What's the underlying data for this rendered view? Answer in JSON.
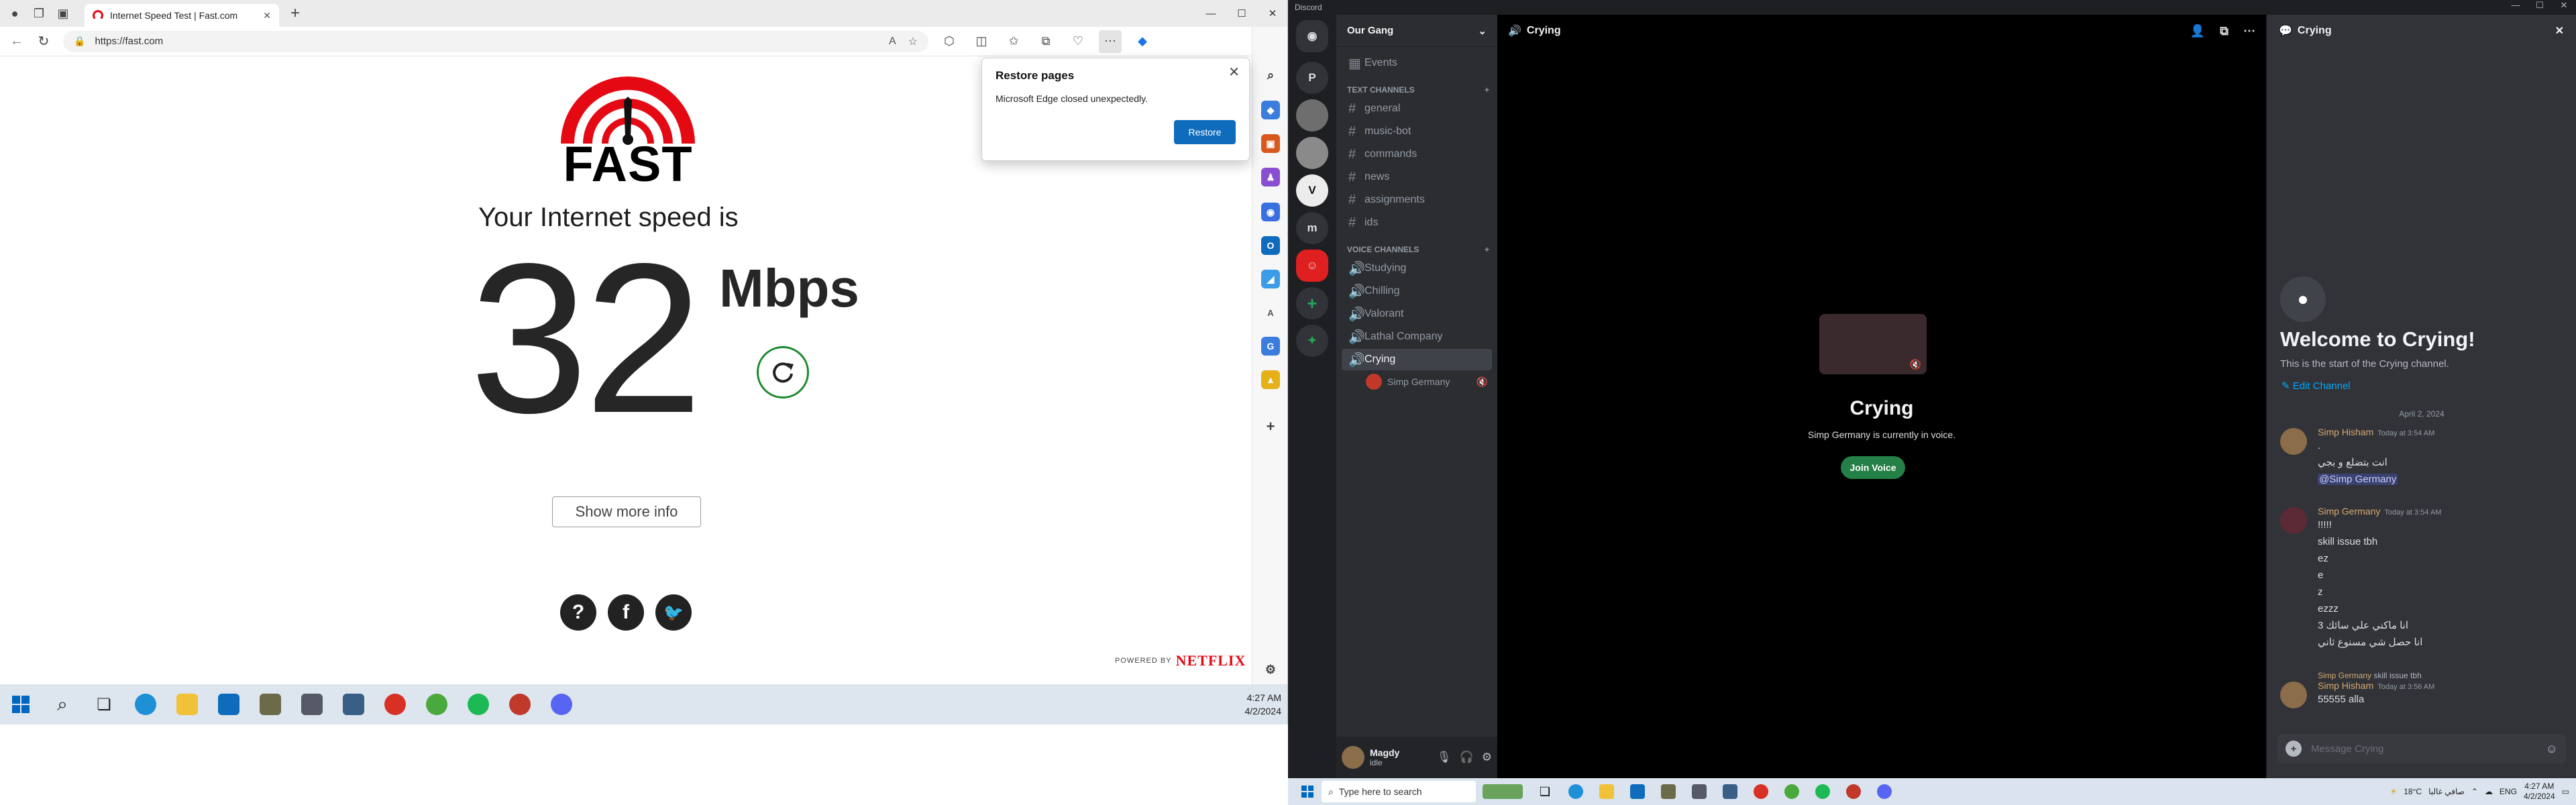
{
  "edge": {
    "tab_title": "Internet Speed Test | Fast.com",
    "url": "https://fast.com"
  },
  "fast": {
    "brand": "FAST",
    "speed_label": "Your Internet speed is",
    "speed_value": "32",
    "speed_unit": "Mbps",
    "more_info": "Show more info",
    "powered_by": "POWERED BY",
    "netflix": "NETFLIX"
  },
  "restore": {
    "title": "Restore pages",
    "message": "Microsoft Edge closed unexpectedly.",
    "button": "Restore"
  },
  "taskbar1": {
    "time": "4:27 AM",
    "date": "4/2/2024"
  },
  "discord": {
    "app_title": "Discord",
    "server": "Our Gang",
    "events": "Events",
    "text_category": "TEXT CHANNELS",
    "text_channels": [
      "general",
      "music-bot",
      "commands",
      "news",
      "assignments",
      "ids"
    ],
    "voice_category": "VOICE CHANNELS",
    "voice_channels": [
      "Studying",
      "Chilling",
      "Valorant",
      "Lathal Company",
      "Crying"
    ],
    "voice_member": "Simp Germany",
    "user": {
      "name": "Magdy",
      "status": "idle"
    },
    "voice_view": {
      "channel": "Crying",
      "title": "Crying",
      "subtitle": "Simp Germany is currently in voice.",
      "join": "Join Voice"
    },
    "chat": {
      "channel": "Crying",
      "welcome": "Welcome to Crying!",
      "start": "This is the start of the Crying channel.",
      "edit": "Edit Channel",
      "date": "April 2, 2024",
      "m1": {
        "author": "Simp Hisham",
        "time": "Today at 3:54 AM",
        "lines": [
          ".",
          "انت بتضلع و بجي"
        ],
        "mention": "@Simp Germany"
      },
      "m2": {
        "author": "Simp Germany",
        "time": "Today at 3:54 AM",
        "lines": [
          "!!!!!",
          "skill issue tbh",
          "ez",
          "e",
          "z",
          "ezzz",
          "انا ماكني علي سائك 3",
          "انا حصل شي مسنوع ثاني"
        ]
      },
      "reply": {
        "author": "Simp Germany",
        "text": "skill issue tbh"
      },
      "m3": {
        "author": "Simp Hisham",
        "time": "Today at 3:56 AM",
        "text": "55555 alla"
      },
      "composer": "Message Crying"
    }
  },
  "taskbar2": {
    "search": "Type here to search",
    "weather": "18°C",
    "weather_text": "صافي غالبا",
    "lang": "ENG",
    "time": "4:27 AM",
    "date": "4/2/2024"
  }
}
